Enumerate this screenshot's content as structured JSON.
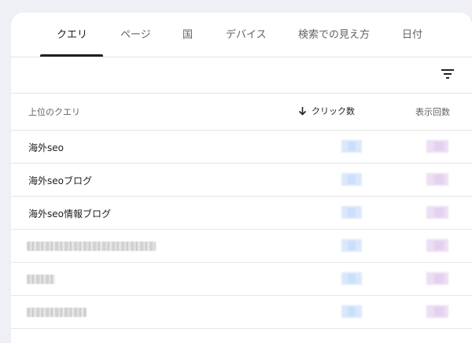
{
  "tabs": [
    {
      "label": "クエリ",
      "active": true
    },
    {
      "label": "ページ",
      "active": false
    },
    {
      "label": "国",
      "active": false
    },
    {
      "label": "デバイス",
      "active": false
    },
    {
      "label": "検索での見え方",
      "active": false
    },
    {
      "label": "日付",
      "active": false
    }
  ],
  "toolbar": {
    "filter_icon": "filter-list-icon"
  },
  "table": {
    "headers": {
      "query": "上位のクエリ",
      "clicks": "クリック数",
      "clicks_sort_icon": "arrow-down-icon",
      "impressions": "表示回数"
    },
    "rows": [
      {
        "query": "海外seo"
      },
      {
        "query": "海外seoブログ"
      },
      {
        "query": "海外seo情報ブログ"
      },
      {
        "query": ""
      },
      {
        "query": ""
      },
      {
        "query": ""
      }
    ]
  },
  "colors": {
    "background": "#eef0f5",
    "card": "#ffffff",
    "active_tab": "#202124",
    "clicks_blur": "#d7e6fb",
    "impressions_blur": "#eadbf2"
  }
}
